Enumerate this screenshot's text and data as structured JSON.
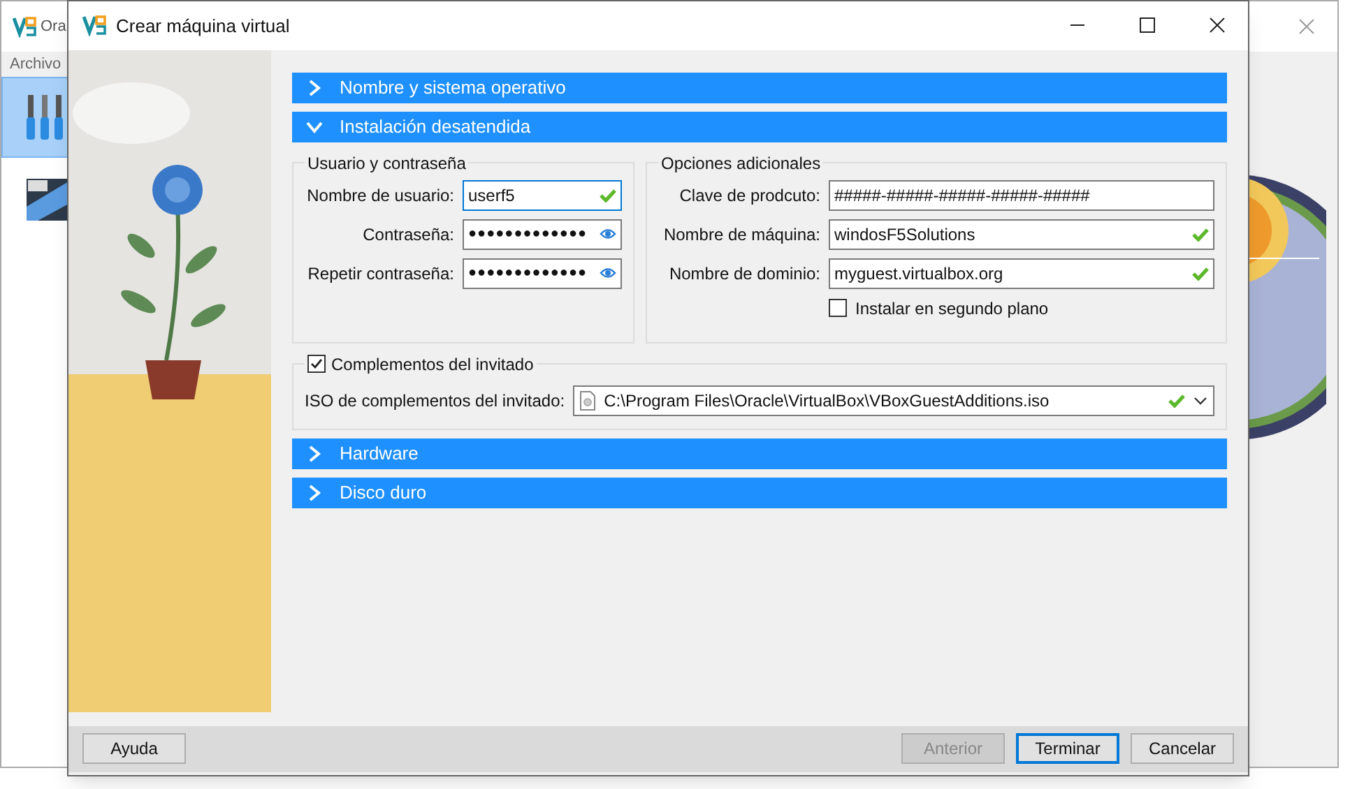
{
  "background_window": {
    "title": "Ora",
    "menu": [
      "Archivo"
    ],
    "tools": [
      {
        "kind": "tools",
        "selected": true
      },
      {
        "kind": "os",
        "selected": false
      }
    ]
  },
  "dialog": {
    "title": "Crear máquina virtual"
  },
  "sections": [
    {
      "title": "Nombre y sistema operativo",
      "expanded": false
    },
    {
      "title": "Instalación desatendida",
      "expanded": true
    },
    {
      "title": "Hardware",
      "expanded": false
    },
    {
      "title": "Disco duro",
      "expanded": false
    }
  ],
  "unattended": {
    "user_group": {
      "title": "Usuario y contraseña",
      "fields": [
        {
          "label": "Nombre de usuario:",
          "value": "userf5",
          "kind": "text",
          "valid": true,
          "focused": true
        },
        {
          "label": "Contraseña:",
          "value": "●●●●●●●●●●●●●",
          "kind": "password",
          "focused": false
        },
        {
          "label": "Repetir contraseña:",
          "value": "●●●●●●●●●●●●●",
          "kind": "password",
          "focused": false
        }
      ]
    },
    "options_group": {
      "title": "Opciones adicionales",
      "fields": [
        {
          "label": "Clave de prodcuto:",
          "value": "#####-#####-#####-#####-#####",
          "kind": "text",
          "valid": false,
          "focused": false
        },
        {
          "label": "Nombre de máquina:",
          "value": "windosF5Solutions",
          "kind": "text",
          "valid": true,
          "focused": false
        },
        {
          "label": "Nombre de dominio:",
          "value": "myguest.virtualbox.org",
          "kind": "text",
          "valid": true,
          "focused": false
        }
      ],
      "background_install": {
        "label": "Instalar en segundo plano",
        "checked": false
      }
    },
    "guest_additions": {
      "label": "Complementos del invitado",
      "checked": true,
      "iso_label": "ISO de complementos del invitado:",
      "iso_value": "C:\\Program Files\\Oracle\\VirtualBox\\VBoxGuestAdditions.iso",
      "valid": true
    }
  },
  "footer": {
    "left_buttons": [
      {
        "label": "Ayuda",
        "disabled": false,
        "default": false
      }
    ],
    "right_buttons": [
      {
        "label": "Anterior",
        "disabled": true,
        "default": false
      },
      {
        "label": "Terminar",
        "disabled": false,
        "default": true
      },
      {
        "label": "Cancelar",
        "disabled": false,
        "default": false
      }
    ]
  }
}
